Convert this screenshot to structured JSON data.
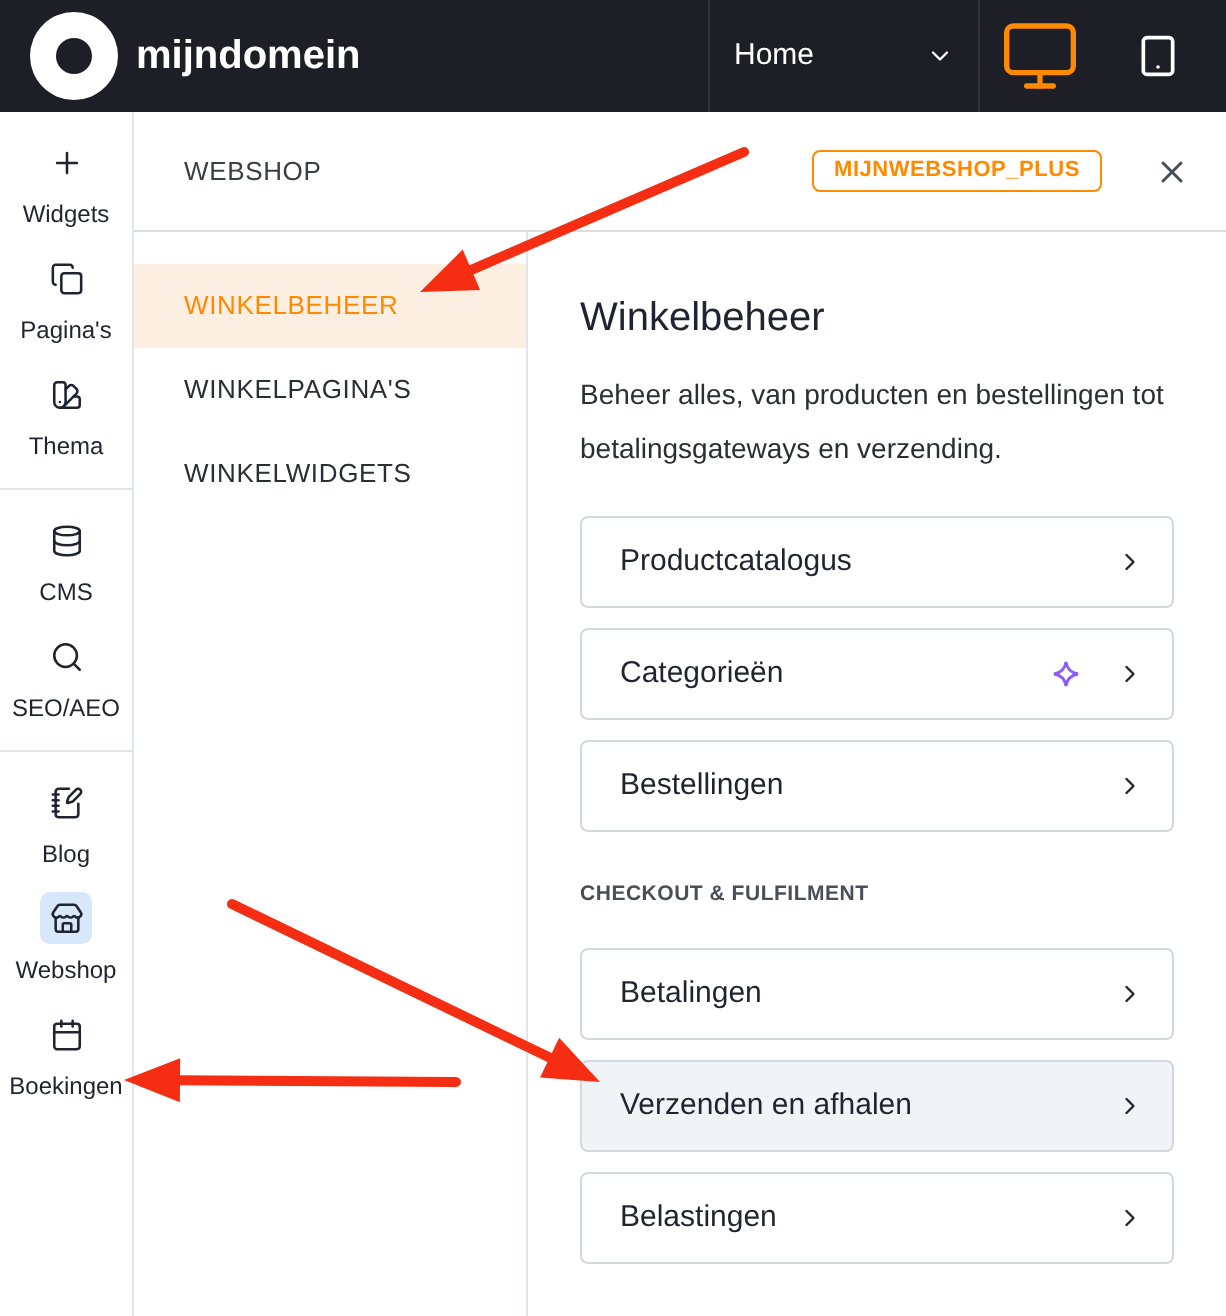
{
  "header": {
    "brand": "mijndomein",
    "page_select": {
      "value": "Home"
    },
    "devices": [
      {
        "kind": "desktop",
        "selected": true
      },
      {
        "kind": "tablet",
        "selected": false
      }
    ]
  },
  "rail": {
    "groups": [
      [
        {
          "label": "Widgets",
          "selected": false
        },
        {
          "label": "Pagina's",
          "selected": false
        },
        {
          "label": "Thema",
          "selected": false
        }
      ],
      [
        {
          "label": "CMS",
          "selected": false
        },
        {
          "label": "SEO/AEO",
          "selected": false
        }
      ],
      [
        {
          "label": "Blog",
          "selected": false
        },
        {
          "label": "Webshop",
          "selected": true
        },
        {
          "label": "Boekingen",
          "selected": false
        }
      ]
    ]
  },
  "panel": {
    "title": "WEBSHOP",
    "badge": "MIJNWEBSHOP_PLUS",
    "menu": [
      {
        "label": "WINKELBEHEER",
        "selected": true
      },
      {
        "label": "WINKELPAGINA'S",
        "selected": false
      },
      {
        "label": "WINKELWIDGETS",
        "selected": false
      }
    ]
  },
  "content": {
    "title": "Winkelbeheer",
    "description": "Beheer alles, van producten en bestellingen tot betalingsgateways en verzending.",
    "sections": [
      {
        "items": [
          {
            "label": "Productcatalogus",
            "sparkle": false,
            "hovered": false
          },
          {
            "label": "Categorieën",
            "sparkle": true,
            "hovered": false
          },
          {
            "label": "Bestellingen",
            "sparkle": false,
            "hovered": false
          }
        ]
      },
      {
        "heading": "CHECKOUT & FULFILMENT",
        "items": [
          {
            "label": "Betalingen",
            "sparkle": false,
            "hovered": false
          },
          {
            "label": "Verzenden en afhalen",
            "sparkle": false,
            "hovered": true
          },
          {
            "label": "Belastingen",
            "sparkle": false,
            "hovered": false
          }
        ]
      }
    ]
  }
}
